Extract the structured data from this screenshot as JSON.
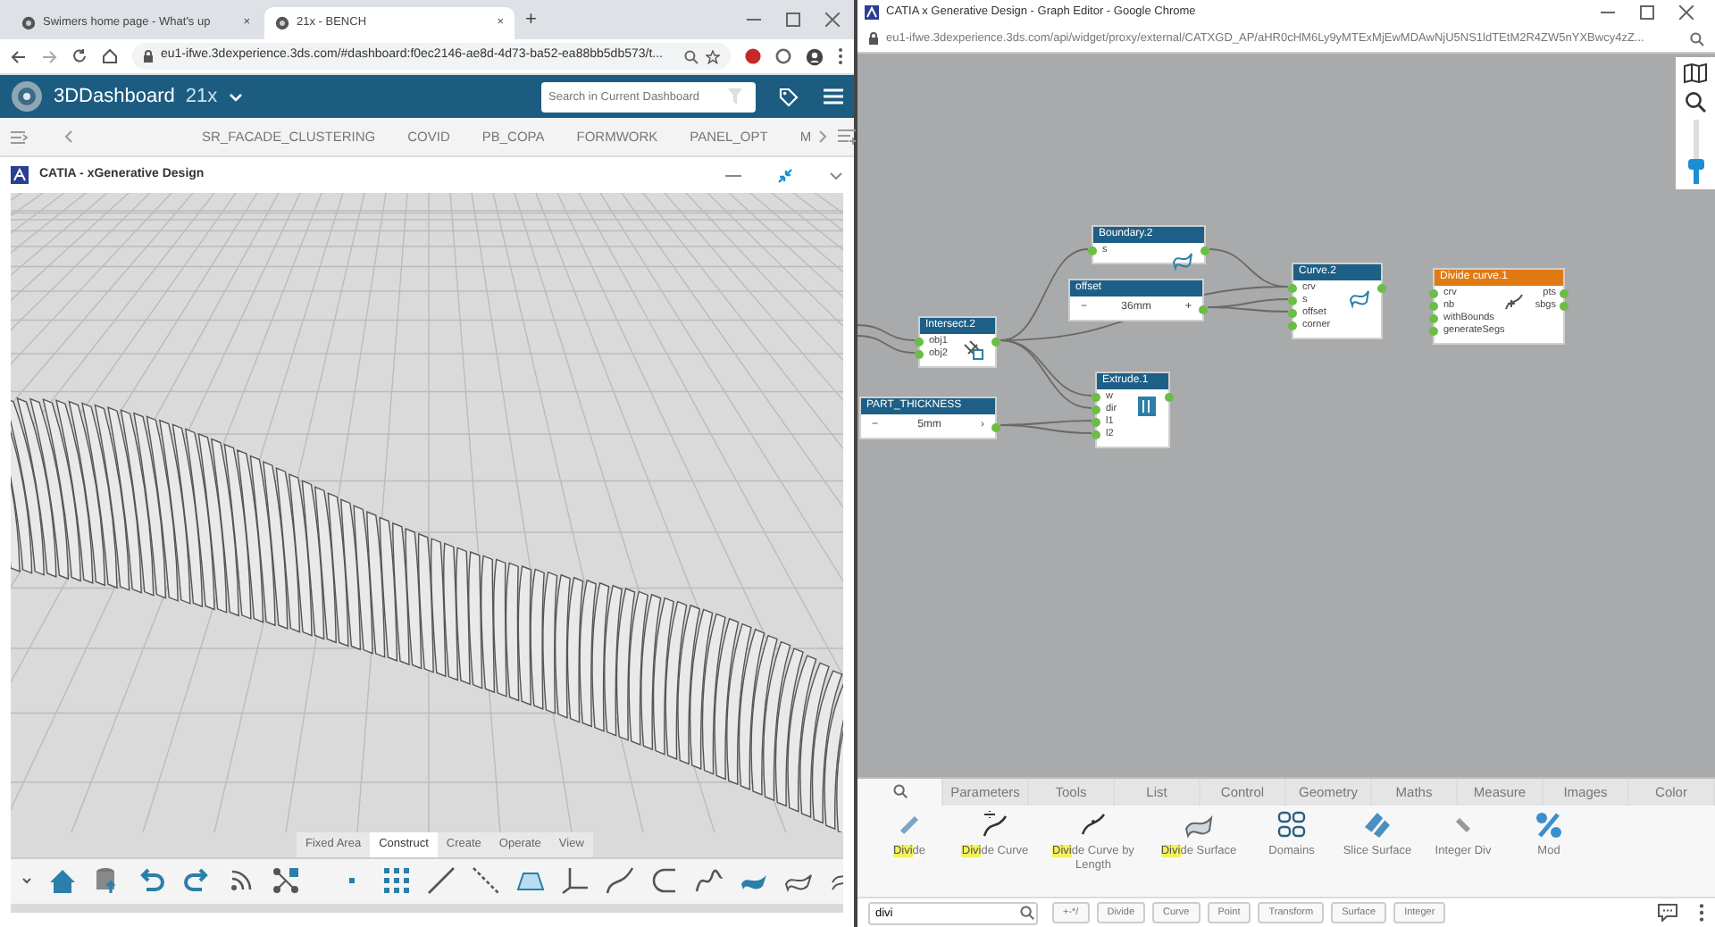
{
  "left_window": {
    "tabs": [
      {
        "title": "Swimers home page - What's up",
        "selected": false,
        "close": "×"
      },
      {
        "title": "21x - BENCH",
        "selected": true,
        "close": "×"
      }
    ],
    "new_tab": "+",
    "address": "eu1-ifwe.3dexperience.3ds.com/#dashboard:f0ec2146-ae8d-4d73-ba52-ea88bb5db573/t...",
    "dashboard": {
      "title": "3DDashboard",
      "version": "21x",
      "search": {
        "placeholder": "Search in Current Dashboard"
      }
    },
    "dashboard_tabs": [
      {
        "label": "SR_FACADE_CLUSTERING",
        "selected": false
      },
      {
        "label": "COVID",
        "selected": false
      },
      {
        "label": "PB_COPA",
        "selected": false
      },
      {
        "label": "FORMWORK",
        "selected": false
      },
      {
        "label": "PANEL_OPT",
        "selected": false
      },
      {
        "label": "M",
        "selected": false
      }
    ],
    "widget": {
      "title": "CATIA - xGenerative Design"
    },
    "toolbar_tabs": [
      {
        "label": "Fixed Area",
        "selected": false
      },
      {
        "label": "Construct",
        "selected": true
      },
      {
        "label": "Create",
        "selected": false
      },
      {
        "label": "Operate",
        "selected": false
      },
      {
        "label": "View",
        "selected": false
      }
    ]
  },
  "right_window": {
    "title": "CATIA x Generative Design - Graph Editor - Google Chrome",
    "address": "eu1-ifwe.3dexperience.3ds.com/api/widget/proxy/external/CATXGD_AP/aHR0cHM6Ly9yMTExMjEwMDAwNjU5NS1ldTEtM2R4ZW5nYXBwcy4zZ...",
    "nodes": [
      {
        "title": "Boundary.2",
        "kind": "operator",
        "selected": false,
        "inputs": [
          "s"
        ]
      },
      {
        "title": "offset",
        "kind": "parameter",
        "selected": false,
        "value": "36mm",
        "decrement": "−",
        "increment": "+"
      },
      {
        "title": "Intersect.2",
        "kind": "operator",
        "selected": false,
        "inputs": [
          "obj1",
          "obj2"
        ]
      },
      {
        "title": "Curve.2",
        "kind": "operator",
        "selected": false,
        "inputs": [
          "crv",
          "s",
          "offset",
          "corner"
        ]
      },
      {
        "title": "Extrude.1",
        "kind": "operator",
        "selected": false,
        "inputs": [
          "w",
          "dir",
          "l1",
          "l2"
        ]
      },
      {
        "title": "PART_THICKNESS",
        "kind": "parameter",
        "selected": false,
        "value": "5mm",
        "decrement": "−",
        "increment": "›"
      },
      {
        "title": "Divide curve.1",
        "kind": "operator",
        "selected": true,
        "inputs": [
          "crv",
          "nb",
          "withBounds",
          "generateSegs"
        ],
        "outputs": [
          "pts",
          "sbgs"
        ]
      }
    ],
    "zoom_slider": {
      "level": 0.3
    },
    "palette": {
      "tabs": [
        {
          "kind": "search",
          "selected": true
        },
        {
          "kind": "text",
          "label": "Parameters",
          "selected": false
        },
        {
          "kind": "text",
          "label": "Tools",
          "selected": false
        },
        {
          "kind": "text",
          "label": "List",
          "selected": false
        },
        {
          "kind": "text",
          "label": "Control",
          "selected": false
        },
        {
          "kind": "text",
          "label": "Geometry",
          "selected": false
        },
        {
          "kind": "text",
          "label": "Maths",
          "selected": false
        },
        {
          "kind": "text",
          "label": "Measure",
          "selected": false
        },
        {
          "kind": "text",
          "label": "Images",
          "selected": false
        },
        {
          "kind": "text",
          "label": "Color",
          "selected": false
        }
      ],
      "items": [
        {
          "match": "Divi",
          "label": "de"
        },
        {
          "match": "Divi",
          "label": "de Curve"
        },
        {
          "match": "Divi",
          "label": "de Curve by Length"
        },
        {
          "match": "Divi",
          "label": "de Surface"
        },
        {
          "label": "Domains"
        },
        {
          "label": "Slice Surface"
        },
        {
          "label": "Integer Div"
        },
        {
          "label": "Mod"
        }
      ],
      "search": {
        "value": "divi"
      },
      "filters": [
        "+-*/",
        "Divide",
        "Curve",
        "Point",
        "Transform",
        "Surface",
        "Integer"
      ]
    }
  }
}
